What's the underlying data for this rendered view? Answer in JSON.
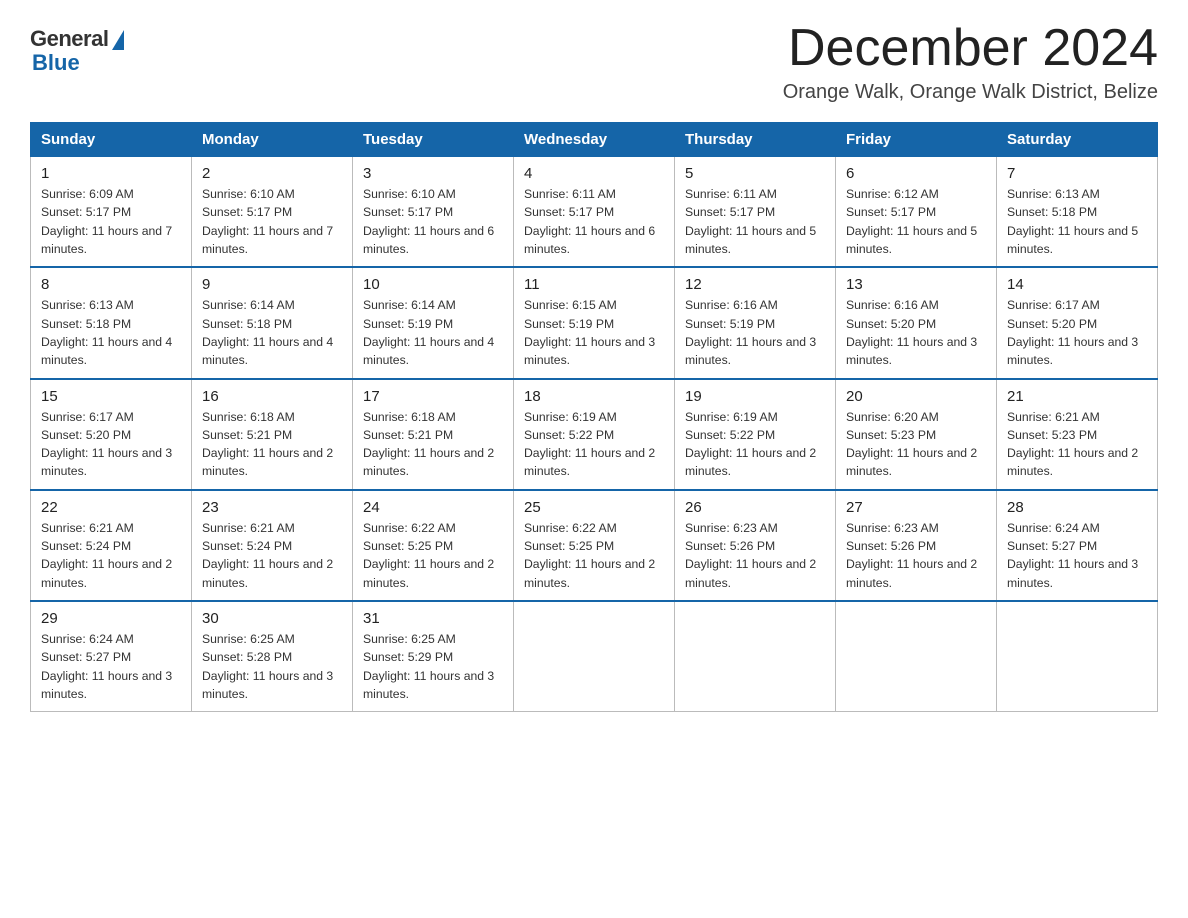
{
  "header": {
    "logo": {
      "general": "General",
      "blue": "Blue"
    },
    "title": "December 2024",
    "location": "Orange Walk, Orange Walk District, Belize"
  },
  "calendar": {
    "days_of_week": [
      "Sunday",
      "Monday",
      "Tuesday",
      "Wednesday",
      "Thursday",
      "Friday",
      "Saturday"
    ],
    "weeks": [
      [
        {
          "day": "1",
          "sunrise": "6:09 AM",
          "sunset": "5:17 PM",
          "daylight": "11 hours and 7 minutes."
        },
        {
          "day": "2",
          "sunrise": "6:10 AM",
          "sunset": "5:17 PM",
          "daylight": "11 hours and 7 minutes."
        },
        {
          "day": "3",
          "sunrise": "6:10 AM",
          "sunset": "5:17 PM",
          "daylight": "11 hours and 6 minutes."
        },
        {
          "day": "4",
          "sunrise": "6:11 AM",
          "sunset": "5:17 PM",
          "daylight": "11 hours and 6 minutes."
        },
        {
          "day": "5",
          "sunrise": "6:11 AM",
          "sunset": "5:17 PM",
          "daylight": "11 hours and 5 minutes."
        },
        {
          "day": "6",
          "sunrise": "6:12 AM",
          "sunset": "5:17 PM",
          "daylight": "11 hours and 5 minutes."
        },
        {
          "day": "7",
          "sunrise": "6:13 AM",
          "sunset": "5:18 PM",
          "daylight": "11 hours and 5 minutes."
        }
      ],
      [
        {
          "day": "8",
          "sunrise": "6:13 AM",
          "sunset": "5:18 PM",
          "daylight": "11 hours and 4 minutes."
        },
        {
          "day": "9",
          "sunrise": "6:14 AM",
          "sunset": "5:18 PM",
          "daylight": "11 hours and 4 minutes."
        },
        {
          "day": "10",
          "sunrise": "6:14 AM",
          "sunset": "5:19 PM",
          "daylight": "11 hours and 4 minutes."
        },
        {
          "day": "11",
          "sunrise": "6:15 AM",
          "sunset": "5:19 PM",
          "daylight": "11 hours and 3 minutes."
        },
        {
          "day": "12",
          "sunrise": "6:16 AM",
          "sunset": "5:19 PM",
          "daylight": "11 hours and 3 minutes."
        },
        {
          "day": "13",
          "sunrise": "6:16 AM",
          "sunset": "5:20 PM",
          "daylight": "11 hours and 3 minutes."
        },
        {
          "day": "14",
          "sunrise": "6:17 AM",
          "sunset": "5:20 PM",
          "daylight": "11 hours and 3 minutes."
        }
      ],
      [
        {
          "day": "15",
          "sunrise": "6:17 AM",
          "sunset": "5:20 PM",
          "daylight": "11 hours and 3 minutes."
        },
        {
          "day": "16",
          "sunrise": "6:18 AM",
          "sunset": "5:21 PM",
          "daylight": "11 hours and 2 minutes."
        },
        {
          "day": "17",
          "sunrise": "6:18 AM",
          "sunset": "5:21 PM",
          "daylight": "11 hours and 2 minutes."
        },
        {
          "day": "18",
          "sunrise": "6:19 AM",
          "sunset": "5:22 PM",
          "daylight": "11 hours and 2 minutes."
        },
        {
          "day": "19",
          "sunrise": "6:19 AM",
          "sunset": "5:22 PM",
          "daylight": "11 hours and 2 minutes."
        },
        {
          "day": "20",
          "sunrise": "6:20 AM",
          "sunset": "5:23 PM",
          "daylight": "11 hours and 2 minutes."
        },
        {
          "day": "21",
          "sunrise": "6:21 AM",
          "sunset": "5:23 PM",
          "daylight": "11 hours and 2 minutes."
        }
      ],
      [
        {
          "day": "22",
          "sunrise": "6:21 AM",
          "sunset": "5:24 PM",
          "daylight": "11 hours and 2 minutes."
        },
        {
          "day": "23",
          "sunrise": "6:21 AM",
          "sunset": "5:24 PM",
          "daylight": "11 hours and 2 minutes."
        },
        {
          "day": "24",
          "sunrise": "6:22 AM",
          "sunset": "5:25 PM",
          "daylight": "11 hours and 2 minutes."
        },
        {
          "day": "25",
          "sunrise": "6:22 AM",
          "sunset": "5:25 PM",
          "daylight": "11 hours and 2 minutes."
        },
        {
          "day": "26",
          "sunrise": "6:23 AM",
          "sunset": "5:26 PM",
          "daylight": "11 hours and 2 minutes."
        },
        {
          "day": "27",
          "sunrise": "6:23 AM",
          "sunset": "5:26 PM",
          "daylight": "11 hours and 2 minutes."
        },
        {
          "day": "28",
          "sunrise": "6:24 AM",
          "sunset": "5:27 PM",
          "daylight": "11 hours and 3 minutes."
        }
      ],
      [
        {
          "day": "29",
          "sunrise": "6:24 AM",
          "sunset": "5:27 PM",
          "daylight": "11 hours and 3 minutes."
        },
        {
          "day": "30",
          "sunrise": "6:25 AM",
          "sunset": "5:28 PM",
          "daylight": "11 hours and 3 minutes."
        },
        {
          "day": "31",
          "sunrise": "6:25 AM",
          "sunset": "5:29 PM",
          "daylight": "11 hours and 3 minutes."
        },
        null,
        null,
        null,
        null
      ]
    ]
  }
}
